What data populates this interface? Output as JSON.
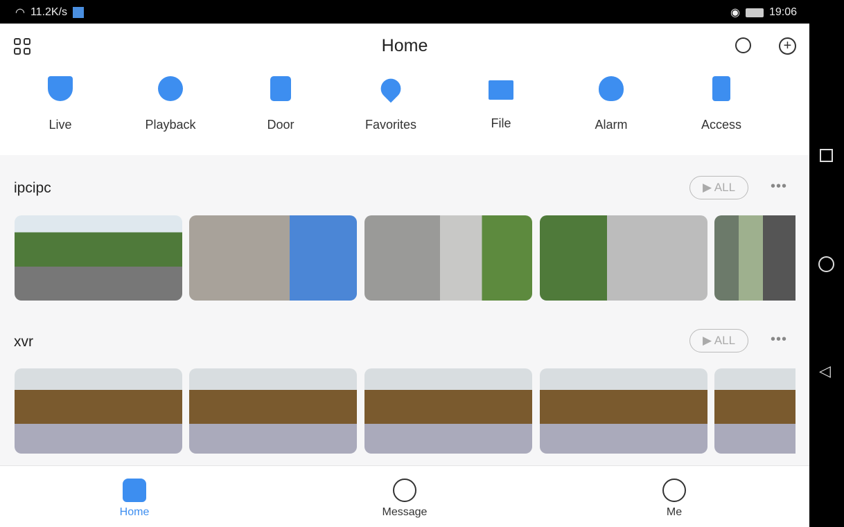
{
  "status": {
    "speed": "11.2K/s",
    "time": "19:06"
  },
  "header": {
    "title": "Home"
  },
  "quick_actions": [
    {
      "label": "Live",
      "icon": "camera-icon"
    },
    {
      "label": "Playback",
      "icon": "playback-icon"
    },
    {
      "label": "Door",
      "icon": "door-icon"
    },
    {
      "label": "Favorites",
      "icon": "heart-icon"
    },
    {
      "label": "File",
      "icon": "folder-icon"
    },
    {
      "label": "Alarm",
      "icon": "alarm-icon"
    },
    {
      "label": "Access",
      "icon": "access-icon"
    }
  ],
  "groups": [
    {
      "name": "ipcipc",
      "all_label": "ALL",
      "more": "•••"
    },
    {
      "name": "xvr",
      "all_label": "ALL",
      "more": "•••"
    }
  ],
  "tabs": [
    {
      "label": "Home"
    },
    {
      "label": "Message"
    },
    {
      "label": "Me"
    }
  ],
  "colors": {
    "accent": "#3d8ef0"
  }
}
